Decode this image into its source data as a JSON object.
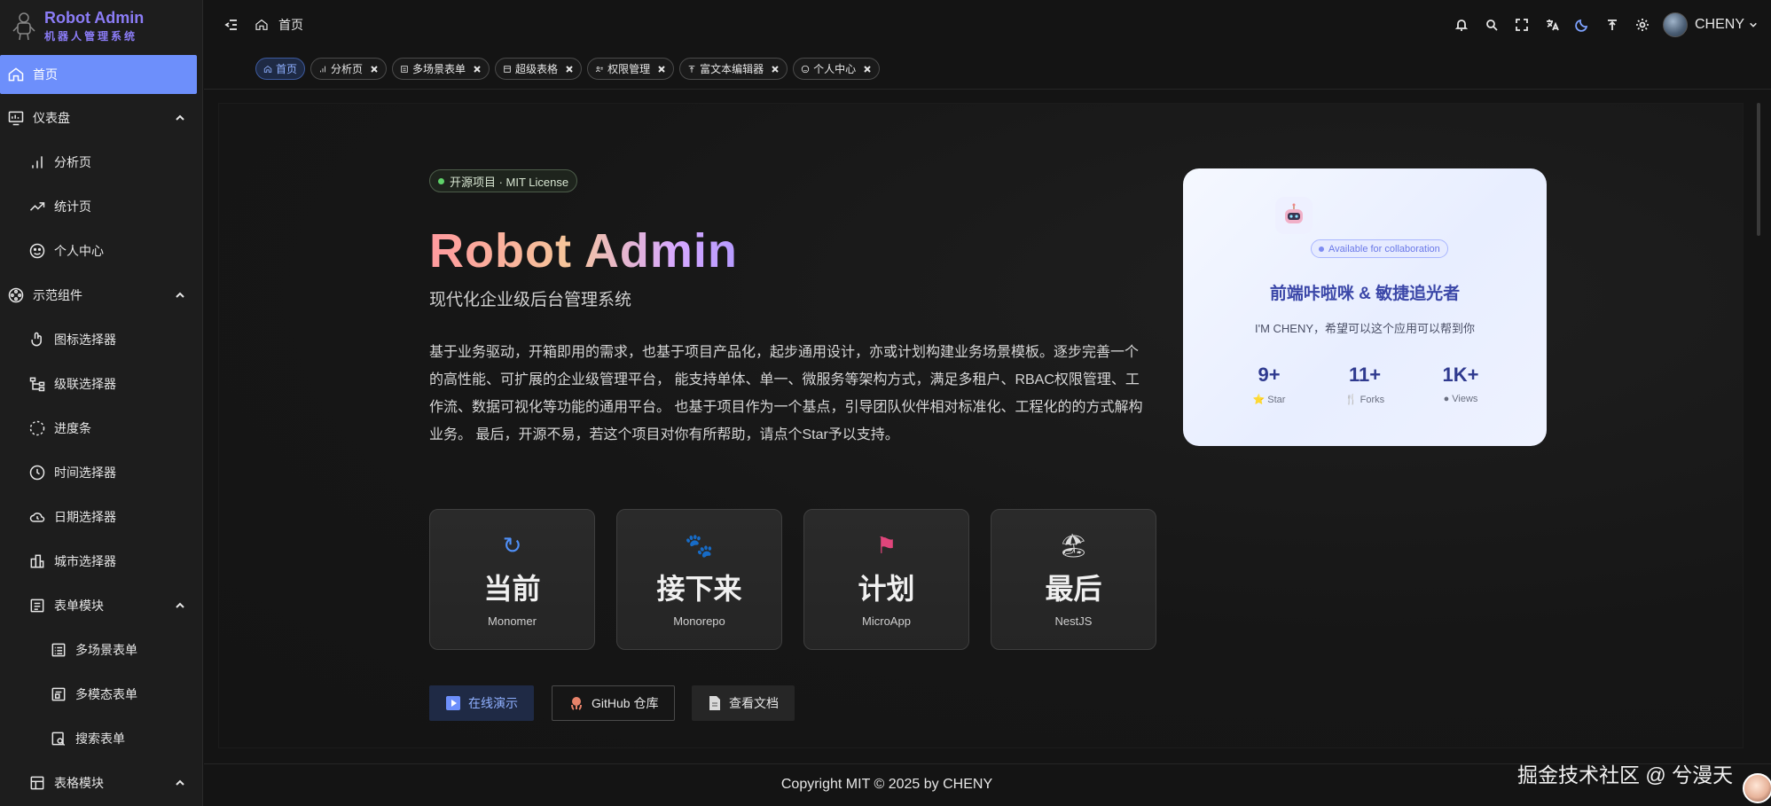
{
  "brand": {
    "title": "Robot Admin",
    "subtitle": "机器人管理系统"
  },
  "sidebar": {
    "items": [
      {
        "label": "首页",
        "icon": "home-icon",
        "active": true
      },
      {
        "label": "仪表盘",
        "icon": "dashboard-icon",
        "expanded": true
      },
      {
        "label": "分析页",
        "icon": "bar-chart-icon"
      },
      {
        "label": "统计页",
        "icon": "trend-icon"
      },
      {
        "label": "个人中心",
        "icon": "user-face-icon"
      },
      {
        "label": "示范组件",
        "icon": "components-icon",
        "expanded": true
      },
      {
        "label": "图标选择器",
        "icon": "icon-picker-icon"
      },
      {
        "label": "级联选择器",
        "icon": "cascader-icon"
      },
      {
        "label": "进度条",
        "icon": "progress-icon"
      },
      {
        "label": "时间选择器",
        "icon": "clock-icon"
      },
      {
        "label": "日期选择器",
        "icon": "calendar-cloud-icon"
      },
      {
        "label": "城市选择器",
        "icon": "city-icon"
      },
      {
        "label": "表单模块",
        "icon": "form-icon",
        "expanded": true
      },
      {
        "label": "多场景表单",
        "icon": "list-form-icon"
      },
      {
        "label": "多模态表单",
        "icon": "modal-form-icon"
      },
      {
        "label": "搜索表单",
        "icon": "search-form-icon"
      },
      {
        "label": "表格模块",
        "icon": "table-icon",
        "expanded": true
      }
    ]
  },
  "header": {
    "breadcrumb": "首页",
    "username": "CHENY"
  },
  "tabs": [
    {
      "label": "首页",
      "active": true
    },
    {
      "label": "分析页"
    },
    {
      "label": "多场景表单"
    },
    {
      "label": "超级表格"
    },
    {
      "label": "权限管理"
    },
    {
      "label": "富文本编辑器"
    },
    {
      "label": "个人中心"
    }
  ],
  "hero": {
    "badge": "开源项目 · MIT License",
    "title": "Robot Admin",
    "subtitle": "现代化企业级后台管理系统",
    "description": "基于业务驱动，开箱即用的需求，也基于项目产品化，起步通用设计，亦或计划构建业务场景模板。逐步完善一个的高性能、可扩展的企业级管理平台， 能支持单体、单一、微服务等架构方式，满足多租户、RBAC权限管理、工作流、数据可视化等功能的通用平台。 也基于项目作为一个基点，引导团队伙伴相对标准化、工程化的的方式解构业务。 最后，开源不易，若这个项目对你有所帮助，请点个Star予以支持。"
  },
  "cards": [
    {
      "icon": "↻",
      "title": "当前",
      "sub": "Monomer",
      "color": "#4f8ff7"
    },
    {
      "icon": "🐾",
      "title": "接下来",
      "sub": "Monorepo",
      "color": "#ff8a3d"
    },
    {
      "icon": "⚑",
      "title": "计划",
      "sub": "MicroApp",
      "color": "#e0457b"
    },
    {
      "icon": "🏖",
      "title": "最后",
      "sub": "NestJS",
      "color": "#ff7a59"
    }
  ],
  "buttons": {
    "demo": "在线演示",
    "github": "GitHub 仓库",
    "docs": "查看文档"
  },
  "profile": {
    "status": "Available for collaboration",
    "name": "前端咔啦咪 & 敏捷追光者",
    "greeting": "I'M CHENY，希望可以这个应用可以帮到你",
    "stats": [
      {
        "value": "9+",
        "label": "Star",
        "icon": "⭐"
      },
      {
        "value": "11+",
        "label": "Forks",
        "icon": "🍴"
      },
      {
        "value": "1K+",
        "label": "Views",
        "icon": "●"
      }
    ]
  },
  "footer": {
    "copyright": "Copyright MIT © 2025 by CHENY",
    "watermark": "掘金技术社区 @ 兮漫天"
  }
}
